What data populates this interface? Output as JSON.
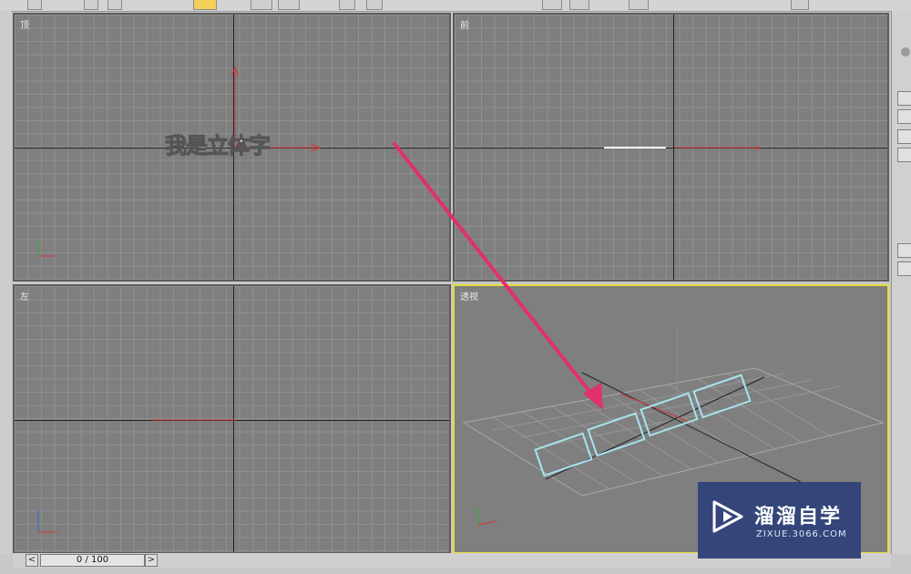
{
  "viewports": {
    "top": {
      "label": "顶"
    },
    "front": {
      "label": "前"
    },
    "left": {
      "label": "左"
    },
    "perspective": {
      "label": "透视"
    }
  },
  "text_object": "我是立体字",
  "timeline": {
    "frame": "0 / 100",
    "prev": "<",
    "next": ">"
  },
  "watermark": {
    "title": "溜溜自学",
    "subtitle": "ZIXUE.3066.COM"
  },
  "colors": {
    "active_border": "#e6dd3a",
    "arrow": "#e0306e",
    "watermark_bg": "#34457a"
  }
}
